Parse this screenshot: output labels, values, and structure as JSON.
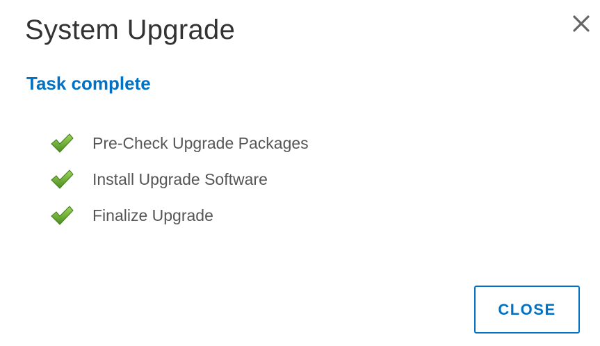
{
  "dialog": {
    "title": "System Upgrade",
    "close_icon": "close-icon",
    "status_text": "Task complete",
    "status_color": "#0072c6",
    "tasks": [
      {
        "label": "Pre-Check Upgrade Packages",
        "status": "complete",
        "icon": "checkmark-icon"
      },
      {
        "label": "Install Upgrade Software",
        "status": "complete",
        "icon": "checkmark-icon"
      },
      {
        "label": "Finalize Upgrade",
        "status": "complete",
        "icon": "checkmark-icon"
      }
    ],
    "close_button_label": "CLOSE"
  },
  "colors": {
    "accent": "#0072c6",
    "check_green": "#6aab2d",
    "title_text": "#333333",
    "body_text": "#565656"
  }
}
